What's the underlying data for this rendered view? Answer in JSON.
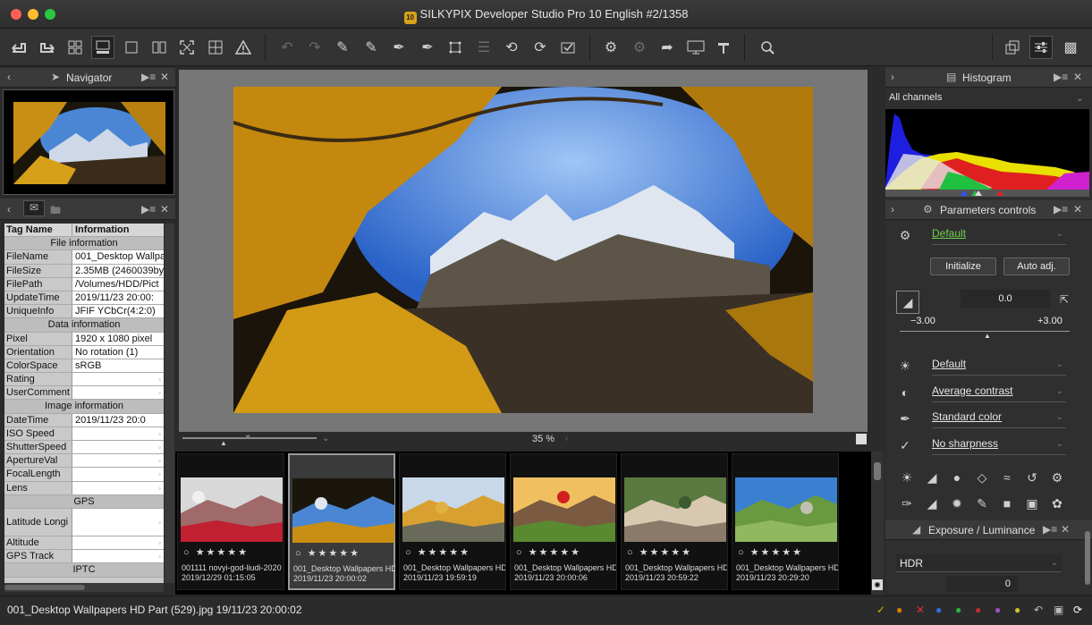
{
  "window": {
    "title": "SILKYPIX Developer Studio Pro 10 English   #2/1358",
    "app_icon": "10"
  },
  "colors": {
    "accent_green": "#6fd14d",
    "selected_thumb_border": "#9a9a9a",
    "close_red": "#ff5f57",
    "min_yellow": "#febc2e",
    "max_green": "#28c840"
  },
  "toolbar": {
    "icons": [
      "back-arrow-icon",
      "forward-arrow-icon",
      "grid-view-icon",
      "filmstrip-view-icon",
      "single-view-icon",
      "compare-view-icon",
      "fullscreen-icon",
      "loupe-grid-icon",
      "warning-icon",
      "undo-icon",
      "redo-icon",
      "copy-params-icon",
      "paste-params-icon",
      "brush-icon",
      "eraser-icon",
      "crop-icon",
      "layers-icon",
      "rotate-left-icon",
      "rotate-right-icon",
      "check-icon",
      "develop-settings-icon",
      "batch-develop-icon",
      "export-icon",
      "display-icon",
      "hammer-icon",
      "search-image-icon",
      "window-icon",
      "sliders-icon",
      "stamp-icon"
    ]
  },
  "navigator": {
    "title": "Navigator"
  },
  "info": {
    "col_tag": "Tag Name",
    "col_info": "Information",
    "rows": [
      {
        "type": "sec",
        "label": "File information"
      },
      {
        "tag": "FileName",
        "val": "001_Desktop Wallpa"
      },
      {
        "tag": "FileSize",
        "val": "2.35MB (2460039by"
      },
      {
        "tag": "FilePath",
        "val": "/Volumes/HDD/Pict"
      },
      {
        "tag": "UpdateTime",
        "val": "2019/11/23 20:00:"
      },
      {
        "tag": "UniqueInfo",
        "val": "JFIF YCbCr(4:2:0)"
      },
      {
        "type": "sec",
        "label": "Data information"
      },
      {
        "tag": "Pixel",
        "val": "1920 x 1080 pixel"
      },
      {
        "tag": "Orientation",
        "val": "No rotation (1)"
      },
      {
        "tag": "ColorSpace",
        "val": "sRGB"
      },
      {
        "tag": "Rating",
        "val": ""
      },
      {
        "tag": "UserComment",
        "val": ""
      },
      {
        "type": "sec",
        "label": "Image information"
      },
      {
        "tag": "DateTime",
        "val": "2019/11/23 20:0"
      },
      {
        "tag": "ISO Speed",
        "val": ""
      },
      {
        "tag": "ShutterSpeed",
        "val": ""
      },
      {
        "tag": "ApertureVal",
        "val": ""
      },
      {
        "tag": "FocalLength",
        "val": ""
      },
      {
        "tag": "Lens",
        "val": ""
      },
      {
        "type": "sec",
        "label": "GPS"
      },
      {
        "tag": "Latitude Longi",
        "val": "",
        "tall": true
      },
      {
        "tag": "Altitude",
        "val": ""
      },
      {
        "tag": "GPS Track",
        "val": ""
      },
      {
        "type": "sec",
        "label": "IPTC"
      }
    ]
  },
  "preview": {
    "zoom": "35 %"
  },
  "filmstrip": [
    {
      "name": "001111 novyi-god-liudi-2020",
      "date": "2019/12/29 01:15:05",
      "rating": "○ ★★★★★",
      "scene": "party"
    },
    {
      "name": "001_Desktop Wallpapers  HD",
      "date": "2019/11/23 20:00:02",
      "rating": "○ ★★★★★",
      "scene": "larch"
    },
    {
      "name": "001_Desktop Wallpapers  HD P",
      "date": "2019/11/23 19:59:19",
      "rating": "○ ★★★★★",
      "scene": "autumn"
    },
    {
      "name": "001_Desktop Wallpapers  HD P",
      "date": "2019/11/23 20:00:06",
      "rating": "○ ★★★★★",
      "scene": "poppies"
    },
    {
      "name": "001_Desktop Wallpapers  HD P",
      "date": "2019/11/23 20:59:22",
      "rating": "○ ★★★★★",
      "scene": "canyon"
    },
    {
      "name": "001_Desktop Wallpapers  HD P",
      "date": "2019/11/23 20:29:20",
      "rating": "○ ★★★★★",
      "scene": "vineyard"
    }
  ],
  "histogram": {
    "title": "Histogram",
    "channel": "All channels"
  },
  "params": {
    "title": "Parameters controls",
    "preset": "Default",
    "initialize": "Initialize",
    "auto_adj": "Auto adj.",
    "exposure_value": "0.0",
    "range_min": "−3.00",
    "range_max": "+3.00",
    "exposure_level": 0.5,
    "wb": "Default",
    "contrast": "Average contrast",
    "color": "Standard color",
    "sharpness": "No sharpness"
  },
  "exposure_panel": {
    "title": "Exposure / Luminance",
    "mode": "HDR",
    "value": "0"
  },
  "status": {
    "text": "001_Desktop Wallpapers  HD Part (529).jpg 19/11/23 20:00:02"
  }
}
